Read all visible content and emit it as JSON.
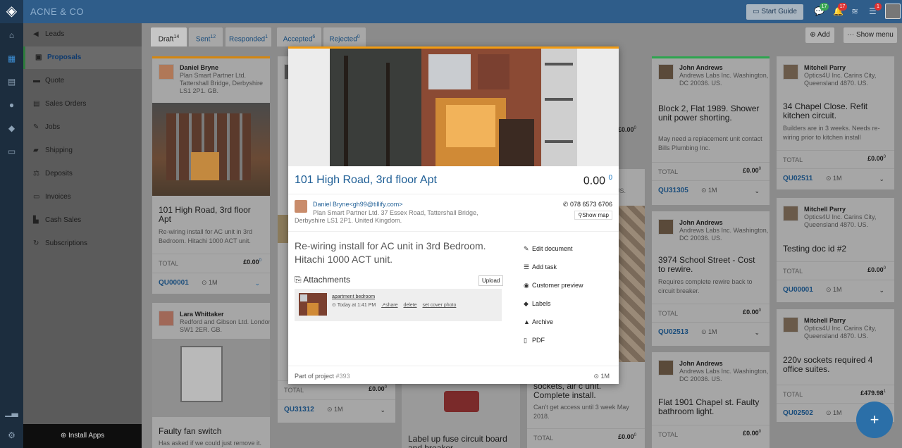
{
  "topbar": {
    "brand": "ACNE & CO",
    "start_guide": "Start Guide",
    "badges": {
      "chat": "17",
      "alerts": "17",
      "tasks": "1"
    }
  },
  "sidebar": {
    "items": [
      {
        "label": "Leads",
        "icon": "bullhorn-icon"
      },
      {
        "label": "Proposals",
        "icon": "briefcase-icon"
      },
      {
        "label": "Quote",
        "icon": "document-icon"
      },
      {
        "label": "Sales Orders",
        "icon": "file-icon"
      },
      {
        "label": "Jobs",
        "icon": "wrench-icon"
      },
      {
        "label": "Shipping",
        "icon": "truck-icon"
      },
      {
        "label": "Deposits",
        "icon": "scale-icon"
      },
      {
        "label": "Invoices",
        "icon": "invoice-icon"
      },
      {
        "label": "Cash Sales",
        "icon": "cart-icon"
      },
      {
        "label": "Subscriptions",
        "icon": "refresh-icon"
      }
    ],
    "install": "Install Apps"
  },
  "tabs": [
    {
      "label": "Draft",
      "count": "14"
    },
    {
      "label": "Sent",
      "count": "12"
    },
    {
      "label": "Responded",
      "count": "1"
    },
    {
      "label": "Accepted",
      "count": "6"
    },
    {
      "label": "Rejected",
      "count": "0"
    }
  ],
  "header": {
    "add": "Add",
    "show_menu": "Show menu"
  },
  "col1": {
    "c1": {
      "name": "Daniel Bryne",
      "address": "Plan Smart Partner Ltd. Tattershall Bridge, Derbyshire LS1 2P1. GB.",
      "title": "101 High Road, 3rd floor Apt",
      "desc": "Re-wiring install for AC unit in 3rd Bedroom. Hitachi 1000 ACT unit.",
      "total_label": "TOTAL",
      "total": "£0.00",
      "sup": "0",
      "code": "QU00001",
      "time": "1M"
    },
    "c2": {
      "name": "Lara Whittaker",
      "address": "Redford and Gibson Ltd. London, SW1 2ER. GB.",
      "title": "Faulty fan switch",
      "desc": "Has asked if we could just remove it."
    }
  },
  "col4": {
    "c1": {
      "name": "John Andrews",
      "address": "Andrews Labs Inc. Washington, DC 20036. US.",
      "title": "Block 2, Flat 1989. Shower unit power shorting.",
      "desc": "May need a replacement unit contact Bills Plumbing Inc.",
      "total_label": "TOTAL",
      "total": "£0.00",
      "sup": "0",
      "code": "QU31305",
      "time": "1M"
    },
    "c2": {
      "name": "John Andrews",
      "address": "Andrews Labs Inc. Washington, DC 20036. US.",
      "title": "3974 School Street - Cost to rewire.",
      "desc": "Requires complete rewire back to circuit breaker.",
      "total_label": "TOTAL",
      "total": "£0.00",
      "sup": "0",
      "code": "QU02513",
      "time": "1M"
    },
    "c3": {
      "name": "John Andrews",
      "address": "Andrews Labs Inc. Washington, DC 20036. US.",
      "title": "Flat 1901 Chapel st. Faulty bathroom light.",
      "total_label": "TOTAL",
      "total": "£0.00",
      "sup": "0"
    }
  },
  "col5": {
    "c1": {
      "name": "Mitchell Parry",
      "address": "Optics4U Inc. Carins City, Queensland 4870. US.",
      "title": "34 Chapel Close. Refit kitchen circuit.",
      "desc": "Builders are in 3 weeks. Needs re-wiring prior to kitchen install",
      "total_label": "TOTAL",
      "total": "£0.00",
      "sup": "0",
      "code": "QU02511",
      "time": "1M"
    },
    "c2": {
      "name": "Mitchell Parry",
      "address": "Optics4U Inc. Carins City, Queensland 4870. US.",
      "title": "Testing doc id #2",
      "total_label": "TOTAL",
      "total": "£0.00",
      "sup": "0",
      "code": "QU00001",
      "time": "1M"
    },
    "c3": {
      "name": "Mitchell Parry",
      "address": "Optics4U Inc. Carins City, Queensland 4870. US.",
      "title": "220v sockets required 4 office suites.",
      "total_label": "TOTAL",
      "total": "£479.98",
      "sup": "1",
      "code": "QU02502",
      "time": "1M"
    }
  },
  "col2": {
    "total_label": "TOTAL",
    "total": "£0.00",
    "sup": "0",
    "code": "QU31312",
    "time": "1M"
  },
  "col3": {
    "title": "Label up fuse circuit board and breaker."
  },
  "colx": {
    "title": "sockets, air c unit. Complete install.",
    "desc": "Can't get access until 3 week May 2018.",
    "total_label": "TOTAL",
    "total": "£0.00",
    "sup": "0",
    "peek_total": "£0.00",
    "peek_sup": "0",
    "peek_us": "US."
  },
  "modal": {
    "title": "101 High Road, 3rd floor Apt",
    "amount": "0.00",
    "amount_sup": "0",
    "contact": "Daniel Bryne<gh99@tillify.com>",
    "address": "Plan Smart Partner Ltd. 37 Essex Road, Tattershall Bridge, Derbyshire LS1 2P1. United Kingdom.",
    "phone": "078 6573 6706",
    "show_map": "Show map",
    "desc": "Re-wiring install for AC unit in 3rd Bedroom. Hitachi 1000 ACT unit.",
    "attachments": "Attachments",
    "upload": "Upload",
    "att_name": "apartment bedroom",
    "att_time": "Today at 1:41 PM",
    "att_share": "share",
    "att_delete": "delete",
    "att_cover": "set cover photo",
    "actions": [
      "Edit document",
      "Add task",
      "Customer preview",
      "Labels",
      "Archive",
      "PDF"
    ],
    "footer_label": "Part of project",
    "footer_id": "#393",
    "footer_time": "1M"
  }
}
